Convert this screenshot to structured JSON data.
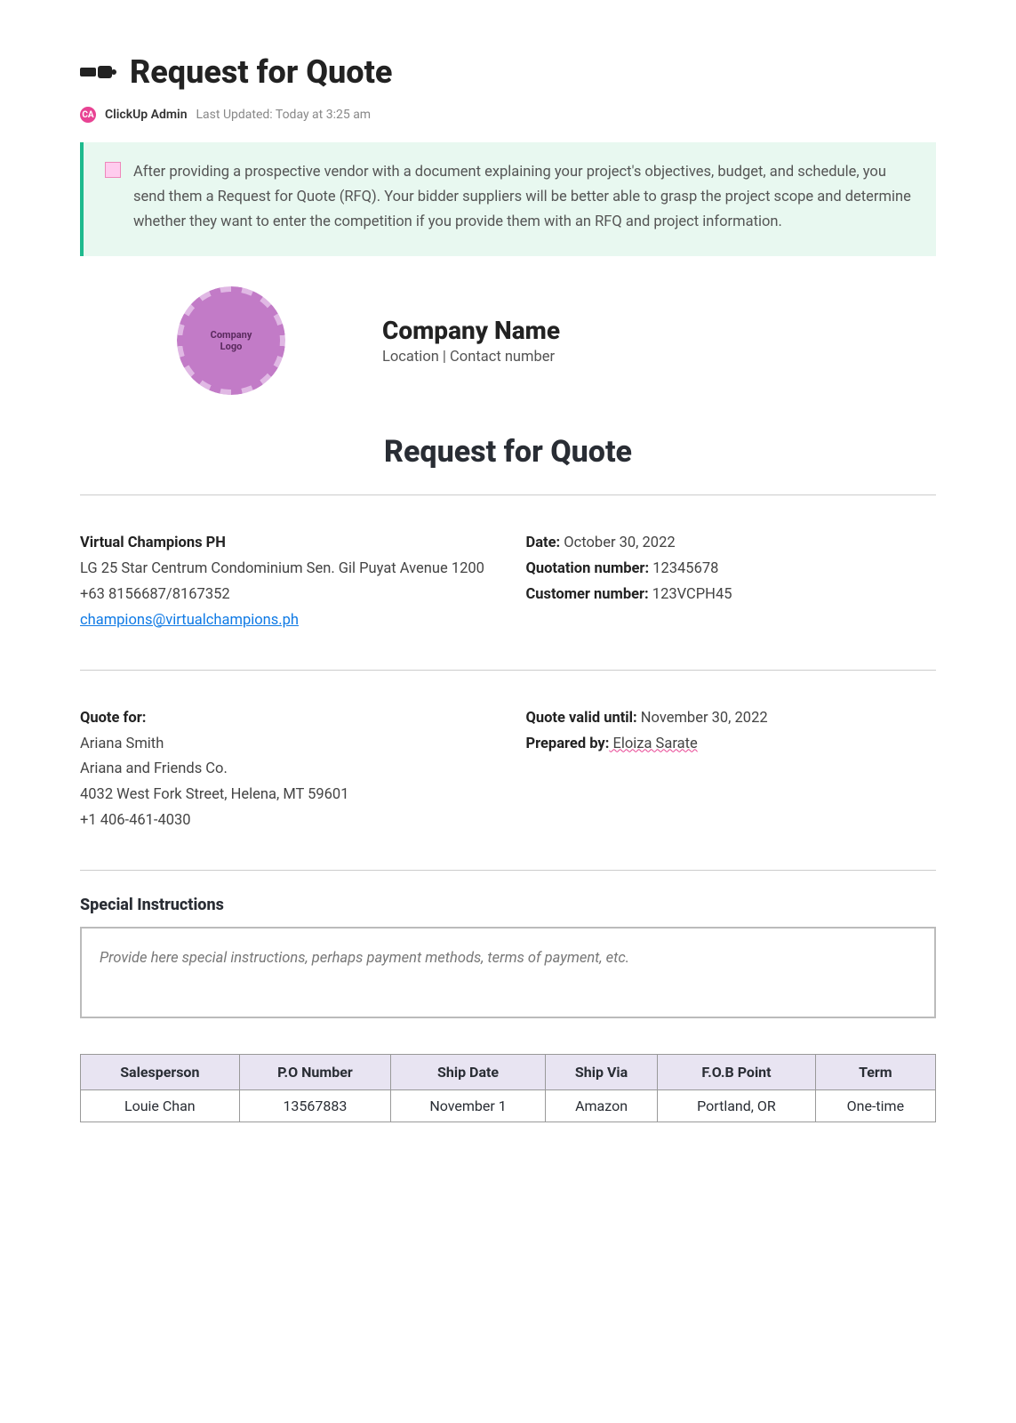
{
  "header": {
    "title": "Request for Quote",
    "avatar_initials": "CA",
    "author": "ClickUp Admin",
    "updated": "Last Updated: Today at 3:25 am"
  },
  "callout": {
    "text": "After providing a prospective vendor with a document explaining your project's objectives, budget, and schedule, you send them a Request for Quote (RFQ). Your bidder suppliers will be better able to grasp the project scope and determine whether they want to enter the competition if you provide them with an RFQ and project information."
  },
  "logo": {
    "line1": "Company",
    "line2": "Logo"
  },
  "company": {
    "name": "Company Name",
    "sub": "Location | Contact number"
  },
  "section_title": "Request for Quote",
  "vendor": {
    "name": "Virtual Champions PH",
    "address": "LG 25 Star Centrum Condominium Sen. Gil Puyat Avenue 1200",
    "phone": "+63 8156687/8167352",
    "email": "champions@virtualchampions.ph"
  },
  "quote_info": {
    "date_label": "Date:",
    "date_value": " October 30, 2022",
    "qnum_label": "Quotation number:",
    "qnum_value": " 12345678",
    "cnum_label": "Customer number:",
    "cnum_value": " 123VCPH45"
  },
  "quote_for": {
    "label": "Quote for:",
    "name": "Ariana Smith",
    "company": "Ariana and Friends Co.",
    "address": "4032 West Fork Street, Helena, MT 59601",
    "phone": "+1 406-461-4030"
  },
  "valid": {
    "valid_label": "Quote valid until:",
    "valid_value": " November 30, 2022",
    "prep_label": "Prepared by:",
    "prep_value": " Eloiza Sarate"
  },
  "instructions": {
    "heading": "Special Instructions",
    "placeholder": "Provide here special instructions, perhaps payment methods, terms of payment, etc."
  },
  "ship_table": {
    "headers": [
      "Salesperson",
      "P.O Number",
      "Ship Date",
      "Ship Via",
      "F.O.B Point",
      "Term"
    ],
    "row": [
      "Louie Chan",
      "13567883",
      "November 1",
      "Amazon",
      "Portland, OR",
      "One-time"
    ]
  }
}
